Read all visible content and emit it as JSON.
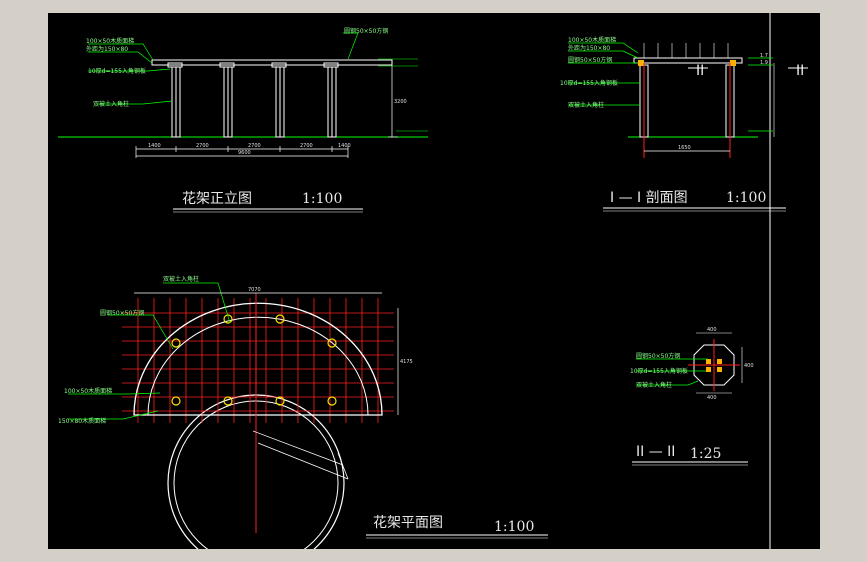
{
  "sheet": {
    "elevation": {
      "title": "花架正立图",
      "scale": "1:100",
      "notes": [
        "100×50木质面梯",
        "外距为150×80",
        "10厚d=155入角钢板",
        "双被土入角柱",
        "圆钢50×50方钢"
      ],
      "dims": [
        "1400",
        "2700",
        "2700",
        "2700",
        "1400",
        "9600",
        "3200"
      ]
    },
    "section": {
      "title": "I — I 剖面图",
      "scale": "1:100",
      "mark_left": "II",
      "mark_right": "II",
      "notes": [
        "100×50木质面梯",
        "外距为150×80",
        "圆钢50×50方钢",
        "10厚d=155入角钢板",
        "双被土入角柱"
      ],
      "dims": [
        "1.7",
        "1.9",
        "1650"
      ]
    },
    "plan": {
      "title": "花架平面图",
      "scale": "1:100",
      "notes": [
        "双被土入角柱",
        "圆钢50×50方钢",
        "100×50木质面梯",
        "150×80木质面梯"
      ],
      "dims": [
        "7070",
        "4175"
      ]
    },
    "detail": {
      "title": "II — II",
      "scale": "1:25",
      "notes": [
        "圆钢50×50方钢",
        "10厚d=155入角钢板",
        "双被土入角柱"
      ],
      "dims": [
        "400",
        "400",
        "400"
      ]
    }
  }
}
